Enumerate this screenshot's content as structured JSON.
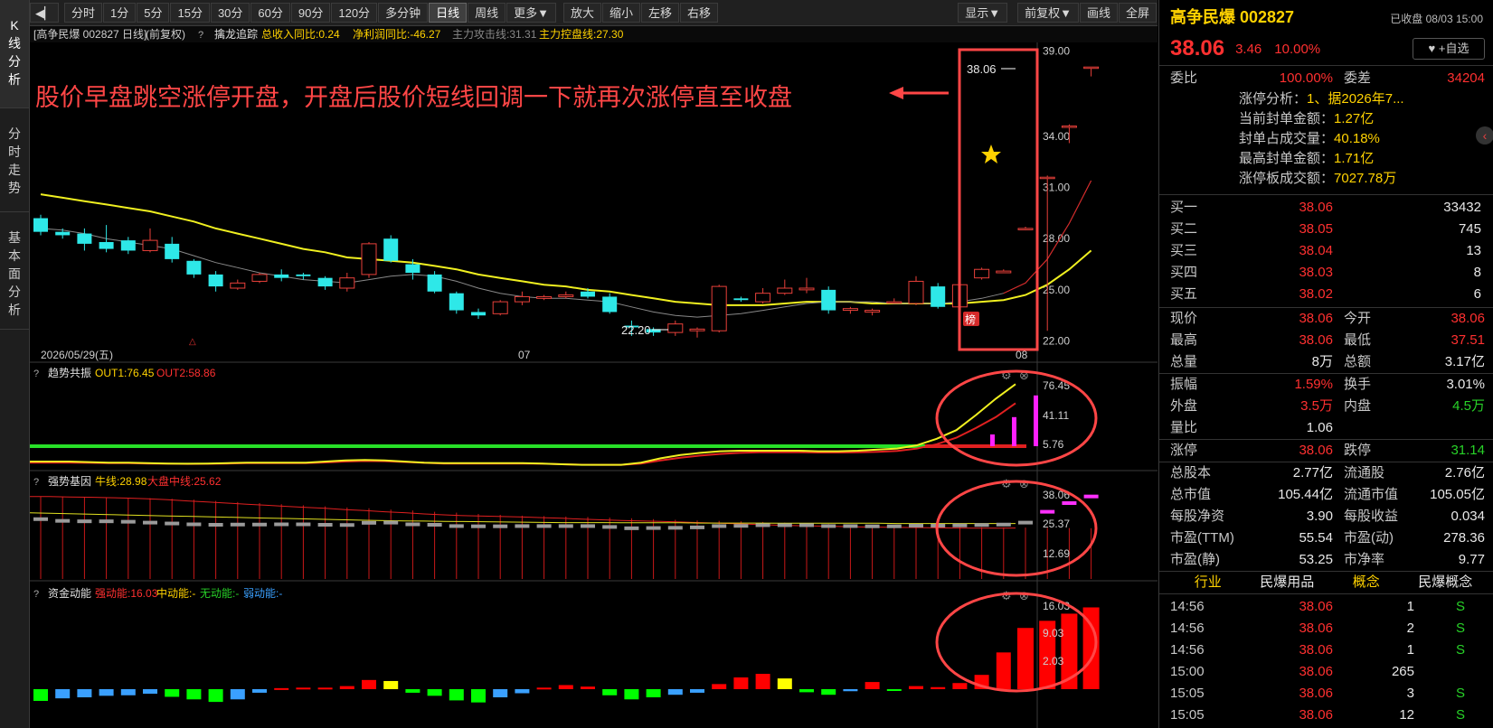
{
  "left_tabs": [
    {
      "label": "K\n线\n分\n析",
      "active": true
    },
    {
      "label": "分\n时\n走\n势",
      "active": false
    },
    {
      "label": "基\n本\n面\n分\n析",
      "active": false
    }
  ],
  "toolbar": {
    "periods": [
      "分时",
      "1分",
      "5分",
      "15分",
      "30分",
      "60分",
      "90分",
      "120分",
      "多分钟",
      "日线",
      "周线",
      "更多▼"
    ],
    "selected": "日线",
    "actions": [
      "放大",
      "缩小",
      "左移",
      "右移"
    ],
    "right_buttons": [
      "显示▼",
      "前复权▼",
      "画线",
      "全屏"
    ]
  },
  "main_header": {
    "stock": "[高争民爆 002827 日线]",
    "adjust": "(前复权)",
    "help": "?",
    "indicator": "擒龙追踪",
    "p1": "总收入同比:0.24",
    "p2": "净利润同比:-46.27",
    "p3": "主力攻击线:31.31",
    "p4": "主力控盘线:27.30"
  },
  "annotation": "股价早盘跳空涨停开盘，开盘后股价短线回调一下就再次涨停直至收盘",
  "price_labels": {
    "high": "38.06",
    "low": "22.20",
    "rank_badge": "榜"
  },
  "x_labels": [
    "2026/05/29(五)",
    "07",
    "08"
  ],
  "y_main": [
    "39.00",
    "34.00",
    "31.00",
    "28.00",
    "25.00",
    "22.00"
  ],
  "panel_trend": {
    "help": "?",
    "name": "趋势共振",
    "a": "OUT1:76.45",
    "b": "OUT2:58.86",
    "y": [
      "76.45",
      "41.11",
      "5.76"
    ]
  },
  "panel_gene": {
    "help": "?",
    "name": "强势基因",
    "a": "牛线:28.98",
    "b": "大盘中线:25.62",
    "y": [
      "38.06",
      "25.37",
      "12.69"
    ]
  },
  "panel_fund": {
    "help": "?",
    "name": "资金动能",
    "a": "强动能:16.03",
    "b": "中动能:-",
    "c": "无动能:-",
    "d": "弱动能:-",
    "y": [
      "16.03",
      "9.03",
      "2.03"
    ]
  },
  "chart_data": {
    "type": "candlestick",
    "ylim": [
      21.5,
      39.5
    ],
    "candles": [
      [
        29.2,
        28.4,
        29.4,
        28.2
      ],
      [
        28.4,
        28.2,
        28.6,
        28.0
      ],
      [
        28.3,
        27.7,
        28.6,
        27.3
      ],
      [
        27.8,
        27.4,
        28.8,
        27.2
      ],
      [
        27.9,
        27.3,
        28.1,
        27.1
      ],
      [
        27.3,
        27.9,
        28.6,
        27.2
      ],
      [
        27.7,
        26.8,
        28.1,
        26.6
      ],
      [
        26.7,
        25.9,
        26.8,
        25.7
      ],
      [
        25.9,
        25.2,
        26.1,
        24.9
      ],
      [
        25.1,
        25.4,
        25.6,
        25.0
      ],
      [
        25.5,
        25.9,
        26.0,
        25.4
      ],
      [
        25.9,
        25.7,
        26.2,
        25.5
      ],
      [
        25.9,
        25.8,
        26.0,
        25.6
      ],
      [
        25.7,
        25.2,
        25.8,
        25.0
      ],
      [
        25.1,
        25.7,
        26.0,
        24.9
      ],
      [
        25.9,
        27.7,
        27.8,
        25.7
      ],
      [
        28.0,
        26.7,
        28.2,
        26.6
      ],
      [
        26.5,
        26.0,
        26.8,
        25.6
      ],
      [
        25.9,
        24.9,
        26.1,
        24.8
      ],
      [
        24.8,
        23.8,
        24.9,
        23.6
      ],
      [
        23.7,
        23.5,
        23.9,
        23.3
      ],
      [
        23.6,
        24.3,
        24.4,
        23.5
      ],
      [
        24.3,
        24.6,
        24.9,
        24.1
      ],
      [
        24.5,
        24.6,
        24.7,
        24.4
      ],
      [
        24.6,
        24.7,
        24.9,
        24.5
      ],
      [
        24.9,
        24.6,
        25.1,
        24.5
      ],
      [
        24.6,
        23.7,
        24.8,
        23.6
      ],
      [
        22.9,
        22.8,
        23.2,
        22.3
      ],
      [
        22.7,
        22.5,
        22.8,
        22.3
      ],
      [
        22.5,
        23.0,
        23.2,
        22.3
      ],
      [
        22.6,
        22.7,
        22.8,
        22.2
      ],
      [
        22.6,
        25.2,
        25.3,
        22.5
      ],
      [
        24.5,
        24.4,
        24.6,
        24.3
      ],
      [
        24.3,
        24.8,
        25.1,
        24.2
      ],
      [
        24.8,
        25.1,
        25.6,
        24.7
      ],
      [
        25.0,
        25.1,
        25.7,
        24.8
      ],
      [
        25.0,
        23.8,
        25.2,
        23.6
      ],
      [
        23.8,
        23.9,
        24.0,
        23.6
      ],
      [
        23.7,
        23.8,
        23.9,
        23.5
      ],
      [
        24.3,
        24.3,
        24.5,
        24.2
      ],
      [
        24.2,
        25.5,
        25.8,
        24.1
      ],
      [
        25.2,
        24.0,
        25.4,
        23.9
      ],
      [
        24.0,
        25.3,
        25.6,
        23.9
      ],
      [
        25.7,
        26.2,
        26.3,
        25.6
      ],
      [
        26.0,
        26.1,
        26.2,
        26.0
      ],
      [
        28.6,
        28.6,
        28.7,
        28.5
      ],
      [
        31.6,
        31.6,
        31.7,
        22.6
      ],
      [
        34.6,
        34.6,
        34.7,
        33.6
      ],
      [
        38.06,
        38.06,
        38.06,
        37.51
      ]
    ],
    "ma_fast": [
      28.6,
      28.5,
      28.3,
      28.0,
      27.8,
      27.6,
      27.4,
      27.0,
      26.6,
      26.3,
      26.0,
      25.8,
      25.6,
      25.5,
      25.4,
      25.6,
      25.8,
      25.9,
      25.8,
      25.5,
      25.1,
      24.8,
      24.6,
      24.5,
      24.5,
      24.4,
      24.3,
      24.0,
      23.7,
      23.5,
      23.4,
      23.5,
      23.6,
      23.8,
      24.0,
      24.2,
      24.3,
      24.3,
      24.3,
      24.2,
      24.2,
      24.2,
      24.3,
      24.5,
      24.8,
      25.4,
      26.8,
      28.9,
      31.4
    ],
    "ma_slow": [
      30.6,
      30.4,
      30.2,
      30.0,
      29.8,
      29.6,
      29.3,
      29.0,
      28.6,
      28.3,
      28.0,
      27.7,
      27.4,
      27.2,
      26.9,
      26.8,
      26.7,
      26.6,
      26.4,
      26.2,
      25.9,
      25.7,
      25.5,
      25.3,
      25.2,
      25.0,
      24.9,
      24.7,
      24.5,
      24.3,
      24.2,
      24.1,
      24.1,
      24.1,
      24.2,
      24.3,
      24.3,
      24.3,
      24.2,
      24.2,
      24.2,
      24.2,
      24.2,
      24.3,
      24.4,
      24.7,
      25.3,
      26.2,
      27.3
    ],
    "trend": {
      "ylim": [
        0,
        80
      ],
      "out1": [
        5,
        5,
        5,
        4.5,
        4,
        4,
        3.6,
        3.2,
        3,
        3.2,
        3.6,
        4,
        4,
        4,
        4,
        5,
        6,
        6.5,
        6,
        5,
        4,
        3.5,
        3.5,
        3.5,
        3.5,
        3.5,
        3.2,
        2.5,
        2,
        2,
        2,
        4,
        8,
        11,
        13,
        14.5,
        15,
        15,
        15,
        15,
        14.5,
        14.5,
        15,
        16,
        17,
        20,
        26,
        34,
        48,
        63,
        76.45
      ],
      "out2": [
        4,
        4,
        4,
        3.8,
        3.5,
        3.5,
        3.2,
        3,
        2.8,
        2.9,
        3.2,
        3.5,
        3.6,
        3.6,
        3.6,
        4.2,
        5,
        5.5,
        5.3,
        4.6,
        3.8,
        3.2,
        3.2,
        3.2,
        3.2,
        3.2,
        3.0,
        2.5,
        2.1,
        2.0,
        2.0,
        3.2,
        6,
        8.5,
        10.5,
        12,
        13,
        13.5,
        13.6,
        13.6,
        13.3,
        13.3,
        13.5,
        14,
        14.8,
        17,
        21,
        27,
        36,
        46,
        58.86
      ],
      "bars": [
        5,
        12,
        24,
        40,
        60
      ]
    },
    "gene": {
      "ylim": [
        0,
        40
      ],
      "bull": [
        38,
        38,
        37.8,
        37.7,
        37.5,
        37.3,
        37.0,
        36.6,
        36.0,
        35.5,
        35.0,
        34.5,
        34.0,
        33.5,
        33.0,
        32.6,
        32.0,
        31.6,
        31.0,
        30.6,
        30.0,
        29.6,
        29.2,
        29.0,
        28.8,
        28.6,
        28.3,
        28.0,
        27.6,
        27.3,
        27.0,
        26.8,
        26.6,
        26.3,
        26.0,
        25.7,
        25.4,
        25.1,
        24.8,
        24.6,
        24.4,
        24.2,
        24.0,
        23.9,
        23.8,
        23.7,
        23.6,
        23.5,
        23.4,
        23.4,
        23.5
      ],
      "mid": [
        30.5,
        30.3,
        30.1,
        29.9,
        29.7,
        29.5,
        29.3,
        29.1,
        28.9,
        28.7,
        28.5,
        28.3,
        28.1,
        27.9,
        27.7,
        27.5,
        27.3,
        27.1,
        26.9,
        26.8,
        26.7,
        26.6,
        26.5,
        26.4,
        26.3,
        26.2,
        26.1,
        26.0,
        26.0,
        26.0,
        25.9,
        25.9,
        25.9,
        25.9,
        25.8,
        25.8,
        25.8,
        25.8,
        25.7,
        25.7,
        25.7,
        25.7,
        25.7,
        25.7,
        25.6,
        25.6,
        25.6,
        25.6,
        25.6,
        25.6,
        25.6
      ],
      "marks": [
        27.6,
        26.8,
        26.6,
        26.6,
        26.4,
        26.0,
        25.6,
        25.2,
        25.0,
        25.1,
        25.1,
        25.2,
        25.2,
        25.0,
        24.9,
        25.9,
        26.0,
        25.2,
        25.0,
        24.4,
        24.3,
        24.3,
        24.4,
        24.4,
        24.4,
        24.4,
        24.0,
        23.4,
        23.5,
        23.6,
        23.8,
        24.4,
        24.5,
        24.8,
        24.8,
        24.8,
        24.4,
        24.4,
        24.3,
        24.3,
        24.6,
        24.6,
        24.7,
        24.9,
        25.1,
        26.0,
        31.0,
        35.0,
        38.06
      ]
    },
    "fund": {
      "ylim": [
        -3,
        17
      ],
      "bars": [
        -2.3,
        -1.8,
        -1.6,
        -1.3,
        -1.2,
        -0.9,
        -1.5,
        -2.0,
        -2.5,
        -2.0,
        -0.7,
        0.2,
        0.3,
        0.3,
        0.6,
        1.8,
        1.6,
        -0.7,
        -1.3,
        -2.2,
        -2.6,
        -1.6,
        -0.8,
        0.3,
        0.8,
        0.5,
        -1.2,
        -2.0,
        -1.6,
        -1.1,
        -0.7,
        1.0,
        2.3,
        3.0,
        2.1,
        -0.6,
        -1.1,
        -0.4,
        1.4,
        -0.2,
        0.6,
        0.4,
        1.2,
        2.8,
        7.2,
        12.0,
        13.4,
        14.8,
        16.03
      ],
      "colors": [
        "lime",
        "#3aa0ff",
        "#3aa0ff",
        "#3aa0ff",
        "#3aa0ff",
        "#3aa0ff",
        "lime",
        "lime",
        "lime",
        "#3aa0ff",
        "#3aa0ff",
        "red",
        "red",
        "red",
        "red",
        "red",
        "yellow",
        "lime",
        "lime",
        "lime",
        "lime",
        "#3aa0ff",
        "#3aa0ff",
        "red",
        "red",
        "red",
        "lime",
        "lime",
        "lime",
        "#3aa0ff",
        "#3aa0ff",
        "red",
        "red",
        "red",
        "yellow",
        "lime",
        "lime",
        "#3aa0ff",
        "red",
        "lime",
        "red",
        "red",
        "red",
        "red",
        "red",
        "red",
        "red",
        "red",
        "red"
      ]
    }
  },
  "quote": {
    "name": "高争民爆 002827",
    "status": "已收盘 08/03 15:00",
    "price": "38.06",
    "change": "3.46",
    "pct": "10.00%",
    "fav": "♥ +自选",
    "weibi_l": "委比",
    "weibi": "100.00%",
    "weicha_l": "委差",
    "weicha": "34204",
    "zt_lines": [
      {
        "k": "涨停分析：",
        "v": "1、据2026年7..."
      },
      {
        "k": "当前封单金额：",
        "v": "1.27亿"
      },
      {
        "k": "封单占成交量：",
        "v": "40.18%"
      },
      {
        "k": "最高封单金额：",
        "v": "1.71亿"
      },
      {
        "k": "涨停板成交额：",
        "v": "7027.78万"
      }
    ],
    "book": [
      {
        "l": "买一",
        "p": "38.06",
        "q": "33432"
      },
      {
        "l": "买二",
        "p": "38.05",
        "q": "745"
      },
      {
        "l": "买三",
        "p": "38.04",
        "q": "13"
      },
      {
        "l": "买四",
        "p": "38.03",
        "q": "8"
      },
      {
        "l": "买五",
        "p": "38.02",
        "q": "6"
      }
    ],
    "stats1": [
      {
        "l": "现价",
        "v": "38.06",
        "vc": "red",
        "l2": "今开",
        "v2": "38.06",
        "v2c": "red"
      },
      {
        "l": "最高",
        "v": "38.06",
        "vc": "red",
        "l2": "最低",
        "v2": "37.51",
        "v2c": "red"
      },
      {
        "l": "总量",
        "v": "8万",
        "vc": "white",
        "l2": "总额",
        "v2": "3.17亿",
        "v2c": "white"
      }
    ],
    "stats2": [
      {
        "l": "振幅",
        "v": "1.59%",
        "vc": "red",
        "l2": "换手",
        "v2": "3.01%",
        "v2c": "white"
      },
      {
        "l": "外盘",
        "v": "3.5万",
        "vc": "red",
        "l2": "内盘",
        "v2": "4.5万",
        "v2c": "green"
      },
      {
        "l": "量比",
        "v": "1.06",
        "vc": "white",
        "l2": "",
        "v2": "",
        "v2c": "white"
      }
    ],
    "stats3": [
      {
        "l": "涨停",
        "v": "38.06",
        "vc": "red",
        "l2": "跌停",
        "v2": "31.14",
        "v2c": "green"
      }
    ],
    "stats4": [
      {
        "l": "总股本",
        "v": "2.77亿",
        "vc": "white",
        "l2": "流通股",
        "v2": "2.76亿",
        "v2c": "white"
      },
      {
        "l": "总市值",
        "v": "105.44亿",
        "vc": "white",
        "l2": "流通市值",
        "v2": "105.05亿",
        "v2c": "white"
      },
      {
        "l": "每股净资",
        "v": "3.90",
        "vc": "white",
        "l2": "每股收益",
        "v2": "0.034",
        "v2c": "white"
      },
      {
        "l": "市盈(TTM)",
        "v": "55.54",
        "vc": "white",
        "l2": "市盈(动)",
        "v2": "278.36",
        "v2c": "white"
      },
      {
        "l": "市盈(静)",
        "v": "53.25",
        "vc": "white",
        "l2": "市净率",
        "v2": "9.77",
        "v2c": "white"
      }
    ],
    "industry": {
      "l": "行业",
      "v": "民爆用品",
      "l2": "概念",
      "v2": "民爆概念"
    },
    "ticks": [
      {
        "t": "14:56",
        "p": "38.06",
        "v": "1",
        "f": "S"
      },
      {
        "t": "14:56",
        "p": "38.06",
        "v": "2",
        "f": "S"
      },
      {
        "t": "14:56",
        "p": "38.06",
        "v": "1",
        "f": "S"
      },
      {
        "t": "15:00",
        "p": "38.06",
        "v": "265",
        "f": ""
      },
      {
        "t": "15:05",
        "p": "38.06",
        "v": "3",
        "f": "S"
      },
      {
        "t": "15:05",
        "p": "38.06",
        "v": "12",
        "f": "S"
      }
    ]
  }
}
